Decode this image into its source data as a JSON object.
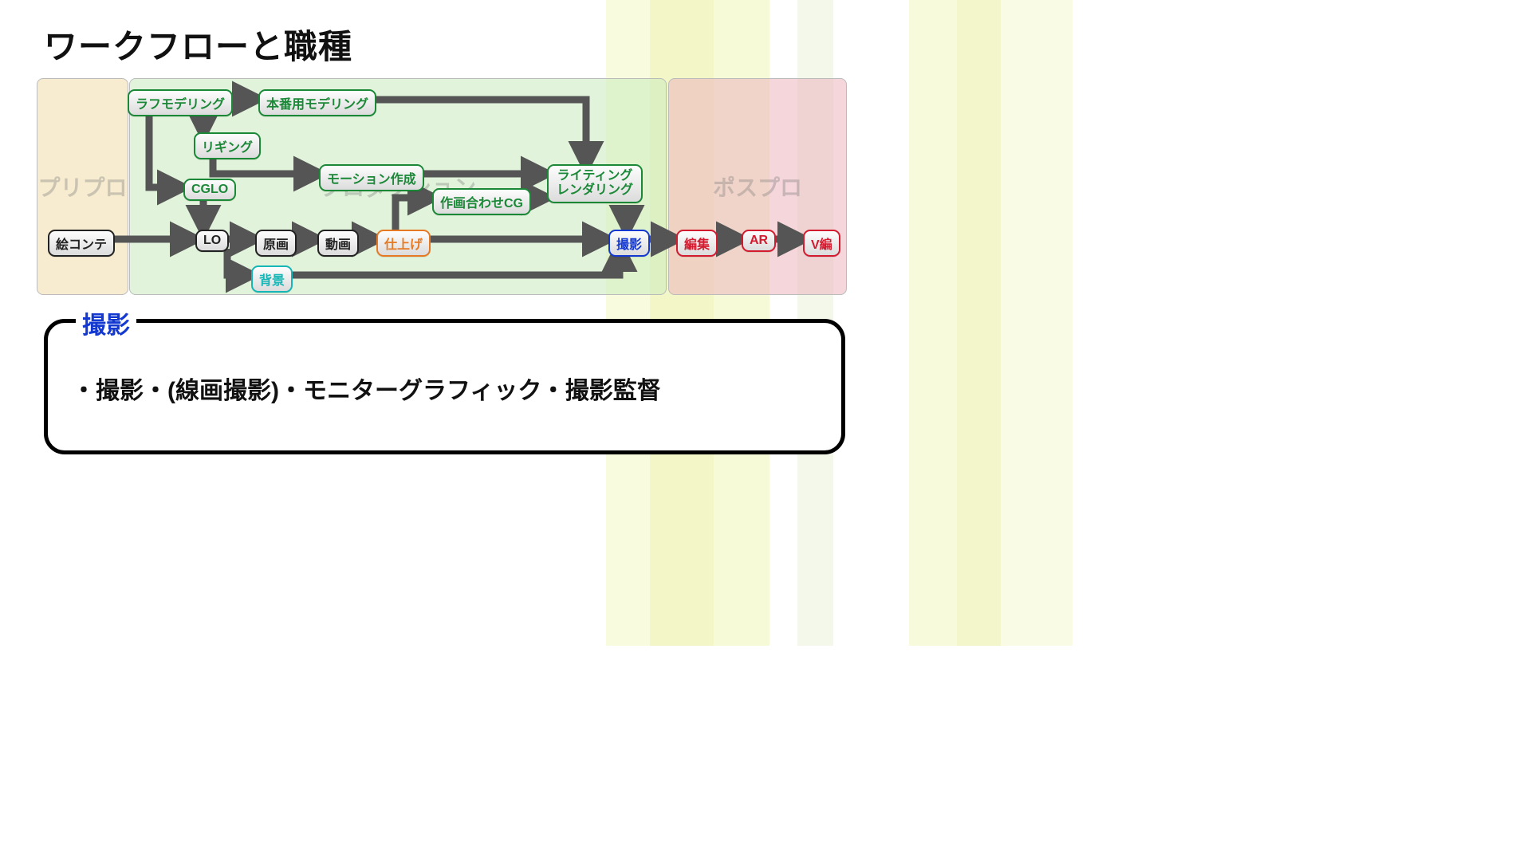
{
  "title": "ワークフローと職種",
  "phases": {
    "pre": "プリプロ",
    "prod": "プロダクション",
    "post": "ポスプロ"
  },
  "nodes": {
    "econte": "絵コンテ",
    "rough": "ラフモデリング",
    "honban": "本番用モデリング",
    "rigging": "リギング",
    "cglo": "CGLO",
    "lo": "LO",
    "genga": "原画",
    "douga": "動画",
    "shiage": "仕上げ",
    "haikei": "背景",
    "motion": "モーション作成",
    "sakuga": "作画合わせCG",
    "lightrend": "ライティング\nレンダリング",
    "satsuei": "撮影",
    "henshu": "編集",
    "ar": "AR",
    "vhen": "V編"
  },
  "callout": {
    "title": "撮影",
    "body": "・撮影・(線画撮影)・モニターグラフィック・撮影監督"
  }
}
